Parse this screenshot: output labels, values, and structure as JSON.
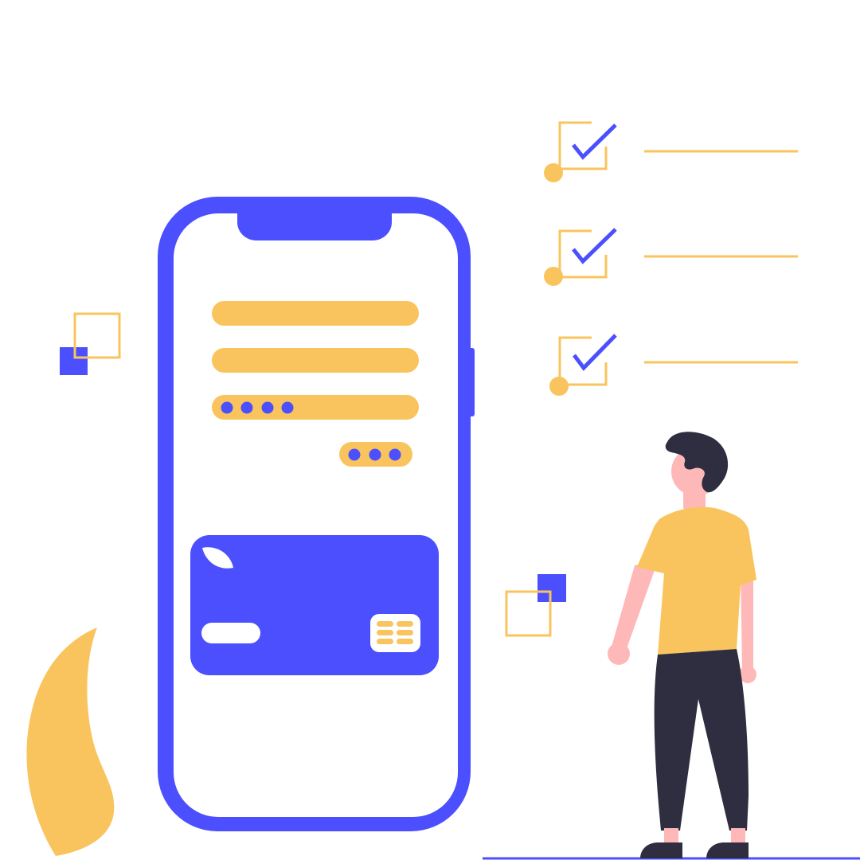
{
  "colors": {
    "primary": "#4b4ffe",
    "accent": "#f9c45d",
    "skin": "#ffb8b8",
    "dark": "#2f2e41",
    "background": "#ffffff"
  },
  "icons": {
    "phone": "smartphone-icon",
    "card": "credit-card-icon",
    "chip": "card-chip-icon",
    "check": "checkmark-icon",
    "person": "person-figure",
    "leaf": "leaf-icon"
  },
  "form": {
    "password_dots": 4,
    "pin_dots": 3
  },
  "checklist": {
    "item_count": 3,
    "all_checked": true
  }
}
